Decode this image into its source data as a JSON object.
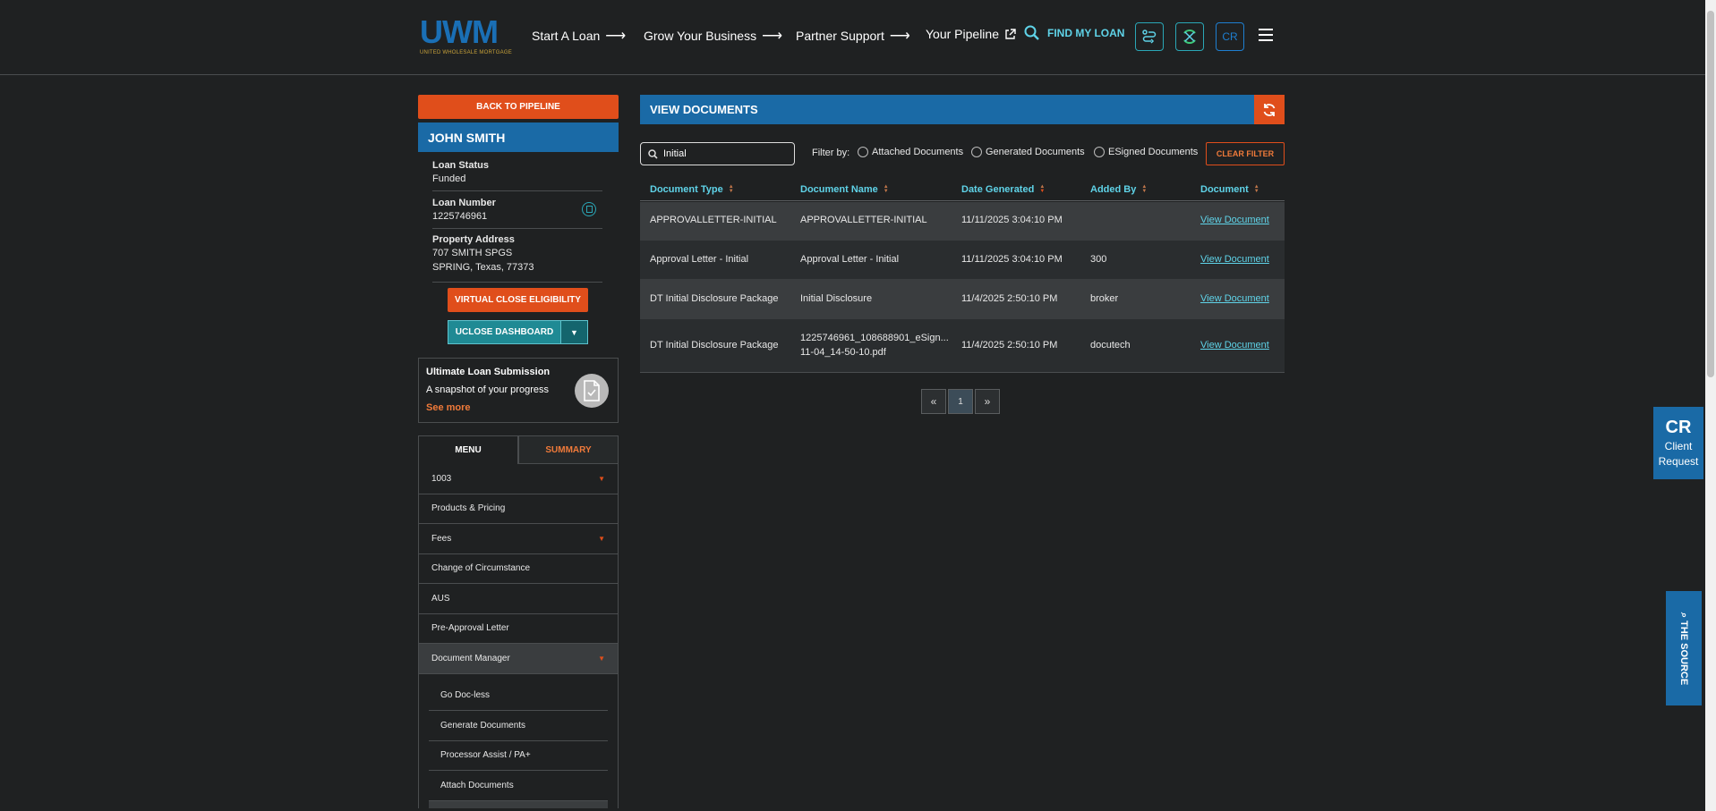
{
  "header": {
    "logo_text": "UWM",
    "logo_tagline": "UNITED WHOLESALE MORTGAGE",
    "nav": [
      {
        "label": "Start A Loan"
      },
      {
        "label": "Grow Your Business"
      },
      {
        "label": "Partner Support"
      },
      {
        "label": "Your Pipeline"
      }
    ],
    "find_my_loan": "FIND MY LOAN",
    "cr_button": "CR"
  },
  "sidebar": {
    "back_button": "BACK TO PIPELINE",
    "borrower_name": "JOHN SMITH",
    "loan_status_label": "Loan Status",
    "loan_status": "Funded",
    "loan_number_label": "Loan Number",
    "loan_number": "1225746961",
    "property_address_label": "Property Address",
    "address_line1": "707 SMITH SPGS",
    "address_line2": "SPRING, Texas, 77373",
    "virtual_close_button": "VIRTUAL CLOSE ELIGIBILITY",
    "uclose_button": "UCLOSE DASHBOARD",
    "uls": {
      "title": "Ultimate Loan Submission",
      "subtitle": "A snapshot of your progress",
      "link": "See more"
    },
    "tabs": {
      "menu": "MENU",
      "summary": "SUMMARY"
    },
    "menu_items": [
      {
        "label": "1003"
      },
      {
        "label": "Products & Pricing"
      },
      {
        "label": "Fees"
      },
      {
        "label": "Change of Circumstance"
      },
      {
        "label": "AUS"
      },
      {
        "label": "Pre-Approval Letter"
      },
      {
        "label": "Document Manager"
      }
    ],
    "submenu_items": [
      {
        "label": "Go Doc-less"
      },
      {
        "label": "Generate Documents"
      },
      {
        "label": "Processor Assist / PA+"
      },
      {
        "label": "Attach Documents"
      }
    ]
  },
  "main": {
    "title": "VIEW DOCUMENTS",
    "search_value": "Initial",
    "filter_label": "Filter by:",
    "filters": [
      "Attached Documents",
      "Generated Documents",
      "ESigned Documents"
    ],
    "clear_filter": "CLEAR FILTER",
    "columns": [
      "Document Type",
      "Document Name",
      "Date Generated",
      "Added By",
      "Document"
    ],
    "rows": [
      {
        "type": "APPROVALLETTER-INITIAL",
        "name": "APPROVALLETTER-INITIAL",
        "name2": "",
        "date": "11/11/2025 3:04:10 PM",
        "added_by": "",
        "link": "View Document"
      },
      {
        "type": "Approval Letter - Initial",
        "name": "Approval Letter - Initial",
        "name2": "",
        "date": "11/11/2025 3:04:10 PM",
        "added_by": "300",
        "link": "View Document"
      },
      {
        "type": "DT Initial Disclosure Package",
        "name": "Initial Disclosure",
        "name2": "",
        "date": "11/4/2025 2:50:10 PM",
        "added_by": "broker",
        "link": "View Document"
      },
      {
        "type": "DT Initial Disclosure Package",
        "name": "1225746961_108688901_eSign...",
        "name2": "11-04_14-50-10.pdf",
        "date": "11/4/2025 2:50:10 PM",
        "added_by": "docutech",
        "link": "View Document"
      }
    ],
    "pager": {
      "prev": "«",
      "current": "1",
      "next": "»"
    }
  },
  "widgets": {
    "client_request_abbr": "CR",
    "client_request_line1": "Client",
    "client_request_line2": "Request",
    "the_source": "THE SOURCE"
  },
  "colors": {
    "background": "#1f2122",
    "brand_blue": "#1a6aa6",
    "accent_orange": "#e04e1b",
    "teal": "#5fd3e8"
  }
}
